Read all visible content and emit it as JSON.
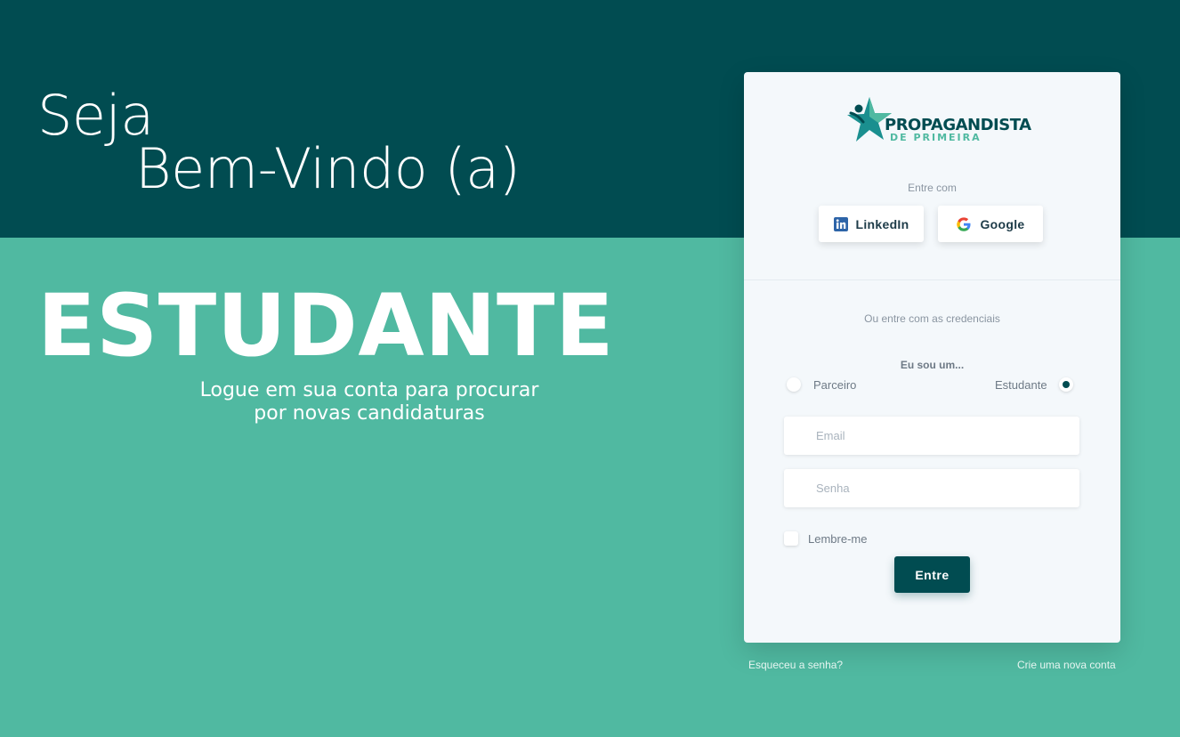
{
  "hero": {
    "welcome_line_1": "Seja",
    "welcome_line_2": "Bem-Vindo (a)",
    "role": "ESTUDANTE",
    "subtitle_line_1": "Logue em sua conta para procurar",
    "subtitle_line_2": "por novas candidaturas"
  },
  "logo": {
    "line_1": "PROPAGANDISTA",
    "line_2": "DE PRIMEIRA"
  },
  "social": {
    "label": "Entre com",
    "linkedin": "LinkedIn",
    "google": "Google"
  },
  "credentials": {
    "label": "Ou entre com as credenciais",
    "role_prompt": "Eu sou um...",
    "roles": [
      {
        "label": "Parceiro",
        "selected": false
      },
      {
        "label": "Estudante",
        "selected": true
      }
    ],
    "email_placeholder": "Email",
    "password_placeholder": "Senha",
    "remember_label": "Lembre-me",
    "submit_label": "Entre"
  },
  "footer": {
    "forgot": "Esqueceu a senha?",
    "signup": "Crie uma nova conta"
  },
  "colors": {
    "dark_teal": "#014c51",
    "light_teal": "#50b9a1",
    "card_bg": "#f4f8fb"
  }
}
